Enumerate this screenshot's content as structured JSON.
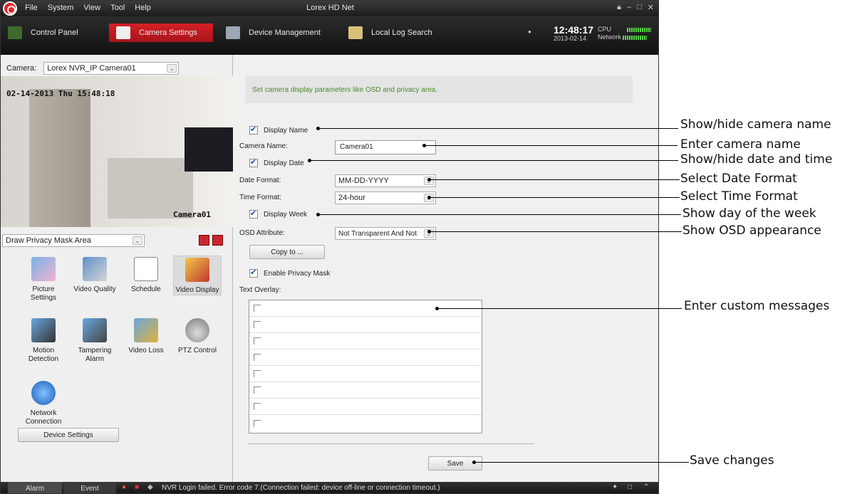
{
  "titlebar": {
    "menu": [
      "File",
      "System",
      "View",
      "Tool",
      "Help"
    ],
    "title": "Lorex HD Net"
  },
  "tabs": [
    {
      "label": "Control Panel",
      "icon": "control-panel-icon"
    },
    {
      "label": "Camera Settings",
      "icon": "camera-settings-icon",
      "active": true
    },
    {
      "label": "Device Management",
      "icon": "device-management-icon"
    },
    {
      "label": "Local Log Search",
      "icon": "log-search-icon"
    }
  ],
  "clock": {
    "time": "12:48:17",
    "date": "2013-02-14"
  },
  "usage": {
    "cpu_label": "CPU",
    "network_label": "Network"
  },
  "left": {
    "camera_label": "Camera:",
    "camera_value": "Lorex NVR_IP Camera01",
    "osd_time": "02-14-2013 Thu 15:48:18",
    "osd_name": "Camera01",
    "privacy_select": "Draw Privacy Mask Area",
    "icons": [
      {
        "label": "Picture Settings",
        "icon": "picture-settings-icon"
      },
      {
        "label": "Video Quality",
        "icon": "video-quality-icon"
      },
      {
        "label": "Schedule",
        "icon": "schedule-icon"
      },
      {
        "label": "Video Display",
        "icon": "video-display-icon",
        "selected": true
      },
      {
        "label": "Motion Detection",
        "icon": "motion-detection-icon"
      },
      {
        "label": "Tampering Alarm",
        "icon": "tampering-alarm-icon"
      },
      {
        "label": "Video Loss",
        "icon": "video-loss-icon"
      },
      {
        "label": "PTZ Control",
        "icon": "ptz-control-icon"
      },
      {
        "label": "Network Connection",
        "icon": "network-connection-icon"
      }
    ],
    "device_settings": "Device Settings"
  },
  "right": {
    "info": "Set camera display parameters like OSD and privacy area.",
    "display_name": "Display Name",
    "camera_name_label": "Camera Name:",
    "camera_name_value": "Camera01",
    "display_date": "Display Date",
    "date_format_label": "Date Format:",
    "date_format_value": "MM-DD-YYYY",
    "time_format_label": "Time Format:",
    "time_format_value": "24-hour",
    "display_week": "Display Week",
    "osd_attr_label": "OSD Attribute:",
    "osd_attr_value": "Not Transparent And Not",
    "copy_to": "Copy to ...",
    "privacy_mask": "Enable Privacy Mask",
    "text_overlay": "Text Overlay:",
    "save": "Save"
  },
  "status": {
    "alarm": "Alarm",
    "event": "Event",
    "message": "NVR Login failed. Error code 7.(Connection failed: device off-line or connection timeout.)"
  },
  "callouts": [
    "Show/hide camera name",
    "Enter camera name",
    "Show/hide date and time",
    "Select Date Format",
    "Select Time Format",
    "Show day of the week",
    "Show OSD appearance",
    "Enter custom messages",
    "Save changes"
  ],
  "colors": {
    "accent": "#d42027",
    "info_text": "#4b8a2b",
    "check": "#1a4fa8"
  }
}
